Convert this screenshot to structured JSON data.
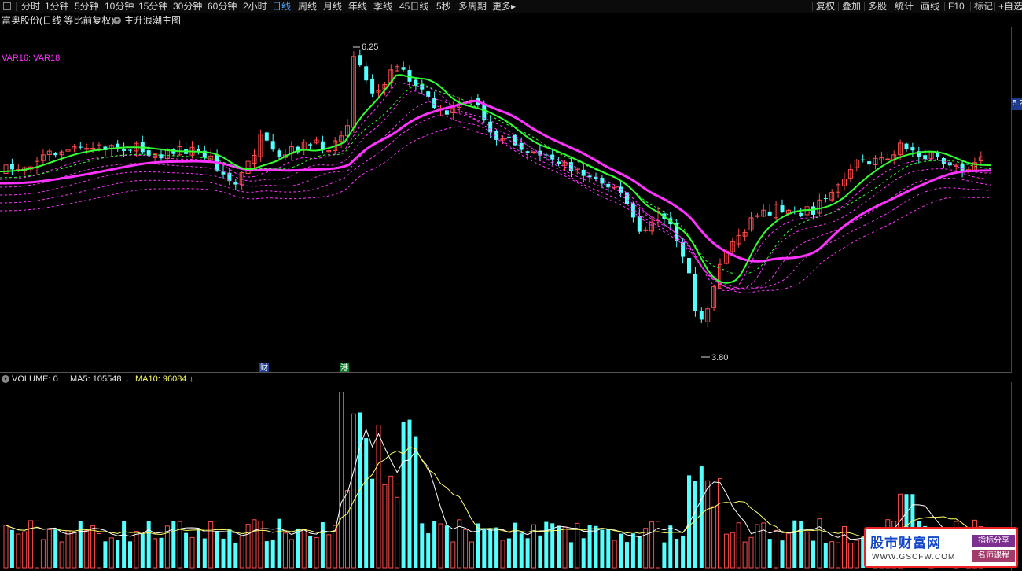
{
  "toolbar": {
    "periods": [
      "分时",
      "1分钟",
      "5分钟",
      "10分钟",
      "15分钟",
      "30分钟",
      "60分钟",
      "2小时",
      "日线",
      "周线",
      "月线",
      "年线",
      "季线",
      "45日线",
      "5秒",
      "多周期",
      "更多"
    ],
    "more_arrow": "▸",
    "active": "日线",
    "right_items": [
      "复权",
      "叠加",
      "多股",
      "统计",
      "画线",
      "F10",
      "标记",
      "+自选"
    ]
  },
  "header": {
    "stock_title": "富奥股份(日线 等比前复权)",
    "formula_name": "主升浪潮主图",
    "indicator_label": "VAR16: VAR18",
    "price_tag": "5.2"
  },
  "annotations": {
    "high_label": "6.25",
    "low_label": "3.80",
    "event_marks": [
      "财",
      "港"
    ]
  },
  "volume_legend": {
    "volume": "VOLUME: 0",
    "ma5": "MA5: 105548",
    "ma10": "MA10: 96084"
  },
  "colors": {
    "up": "#ff4c4c",
    "down": "#54ffff",
    "ma_pink": "#ff33ff",
    "ma_green": "#33ff33",
    "ma5_line": "#ffffff",
    "ma10_line": "#ffff66",
    "active_tab": "#4aa3ff"
  },
  "watermark": {
    "brand": "股市财富网",
    "url": "WWW.GSCFW.COM",
    "tag1": "指标分享",
    "tag2": "名师课程"
  },
  "chart_data": {
    "type": "candlestick",
    "price_high": 6.25,
    "price_low": 3.8,
    "series": [
      {
        "name": "VAR16"
      },
      {
        "name": "VAR18"
      }
    ]
  }
}
